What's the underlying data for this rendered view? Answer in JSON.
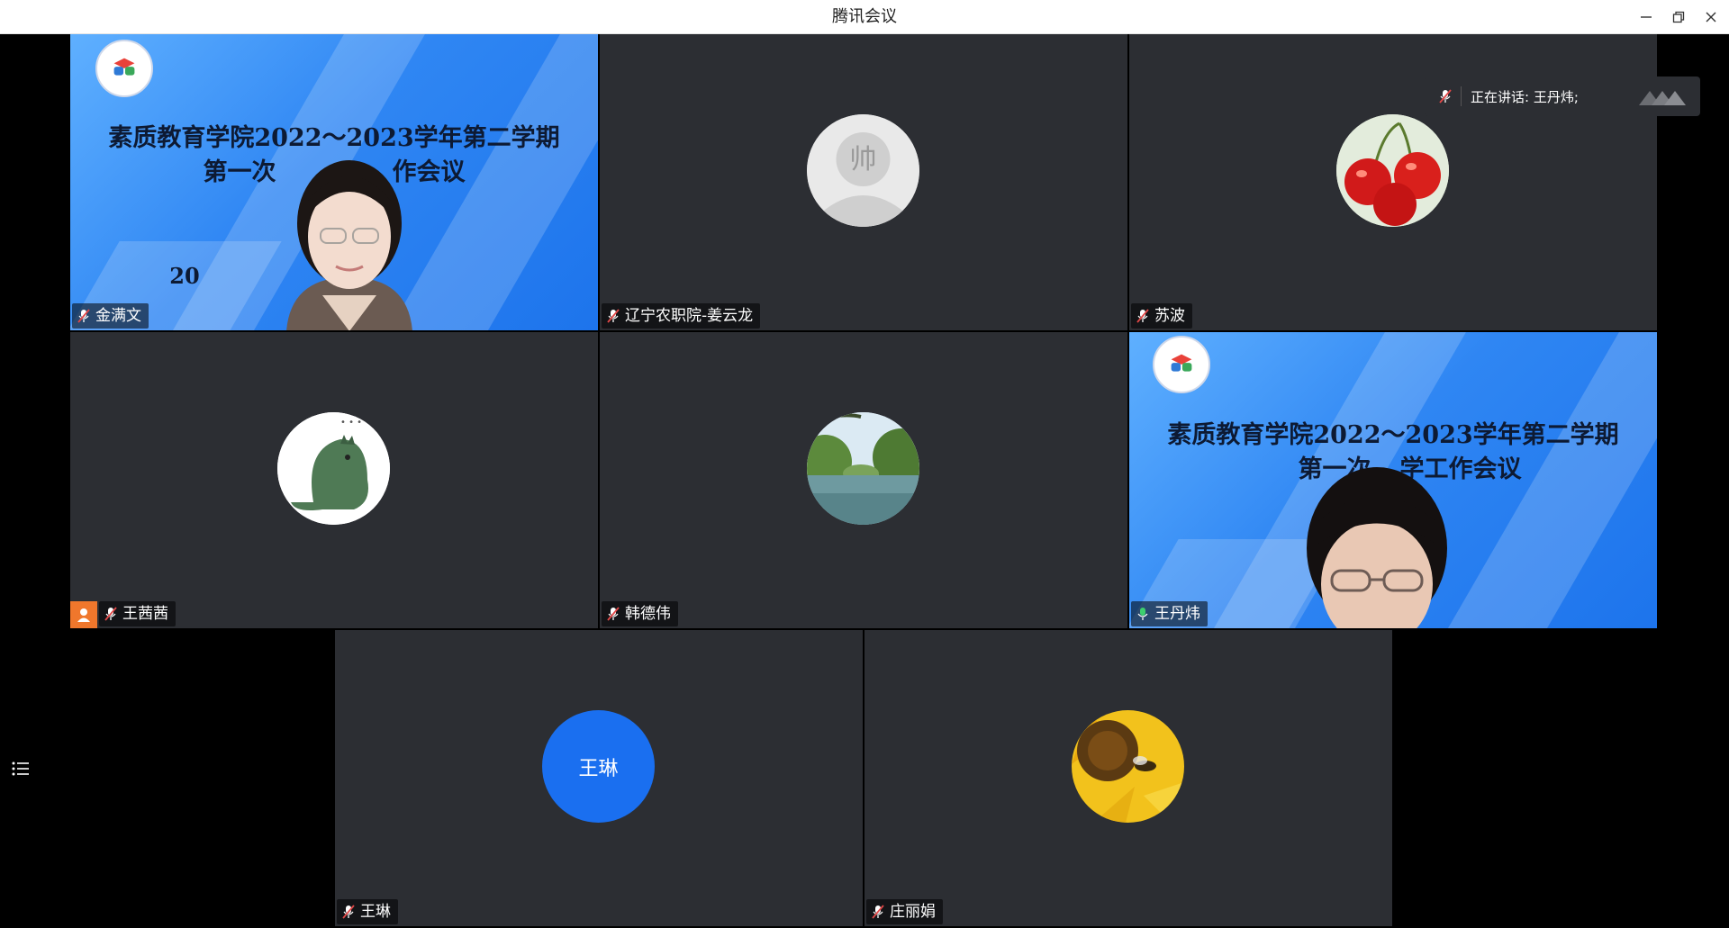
{
  "window": {
    "title": "腾讯会议"
  },
  "speaking": {
    "text": "正在讲话: 王丹炜;"
  },
  "participants": [
    {
      "name": "金满文"
    },
    {
      "name": "辽宁农职院-姜云龙",
      "avatar_text": "帅"
    },
    {
      "name": "苏波"
    },
    {
      "name": "王茜茜"
    },
    {
      "name": "韩德伟"
    },
    {
      "name": "王丹炜"
    },
    {
      "name": "王琳",
      "avatar_text": "王琳"
    },
    {
      "name": "庄丽娟"
    }
  ],
  "slide": {
    "line1": "素质教育学院2022～2023学年第二学期",
    "line2_left": "第一次",
    "line2_right": "作会议",
    "line2b_left": "第一次",
    "line2b_right": "学工作会议",
    "fragment": "20"
  },
  "colors": {
    "tile_bg": "#2c2e33",
    "active_border": "#2fb55a",
    "avatar_blue": "#1a6ff0",
    "host_badge": "#f0772c"
  }
}
